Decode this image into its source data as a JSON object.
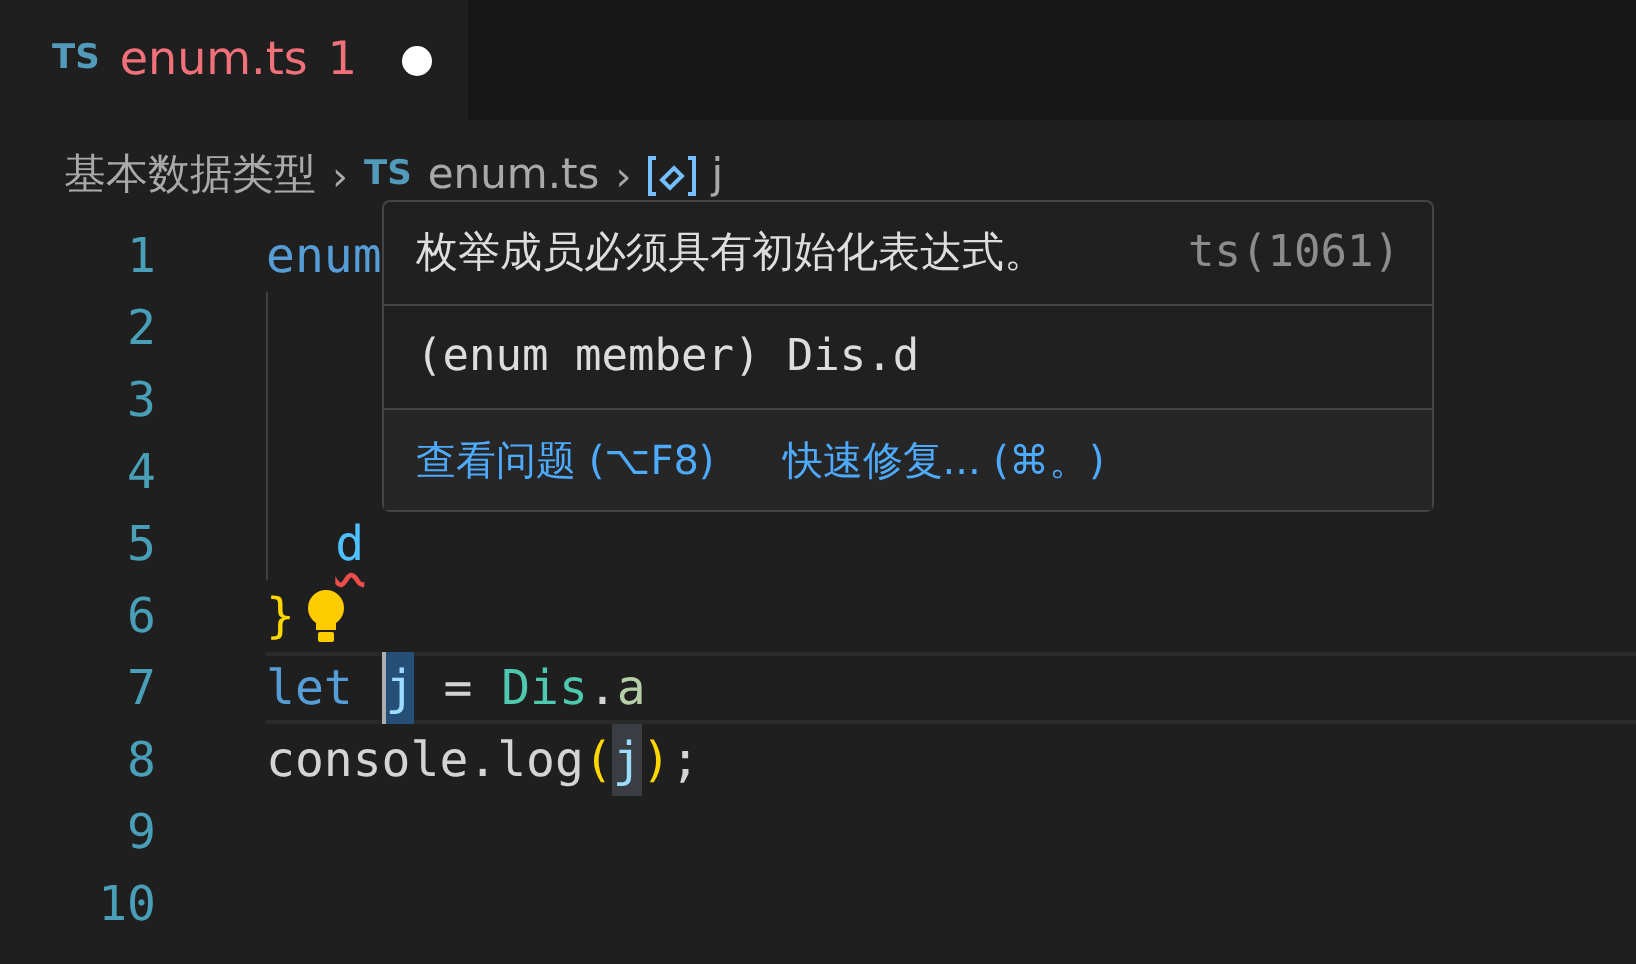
{
  "tab": {
    "icon_text": "TS",
    "name": "enum.ts",
    "problems": "1",
    "dirty": true,
    "selected": true
  },
  "breadcrumbs": [
    {
      "kind": "folder",
      "text": "基本数据类型"
    },
    {
      "kind": "file",
      "separator": "›",
      "icon_text": "TS",
      "text": "enum.ts"
    },
    {
      "kind": "symbol",
      "separator": "›",
      "text": "j"
    }
  ],
  "lines": [
    {
      "number": "1",
      "tokens": [
        {
          "kind": "keyword",
          "text": "enum"
        }
      ],
      "children": [
        {
          "number": "2"
        },
        {
          "number": "3"
        },
        {
          "number": "4"
        },
        {
          "number": "5",
          "tokens": [
            {
              "kind": "member",
              "text": "d",
              "error": true
            }
          ]
        }
      ]
    },
    {
      "number": "6",
      "lightbulb": true,
      "tokens": [
        {
          "kind": "bracket",
          "text": "}"
        }
      ]
    },
    {
      "number": "7",
      "current": true,
      "tokens": [
        {
          "kind": "keyword",
          "text": "let"
        },
        {
          "kind": "variable",
          "text": "j",
          "highlighted": true
        },
        {
          "kind": "plain",
          "text": " = "
        },
        {
          "kind": "type",
          "text": "Dis"
        },
        {
          "kind": "plain",
          "text": "."
        },
        {
          "kind": "member",
          "text": "a"
        }
      ]
    },
    {
      "number": "8",
      "tokens": [
        {
          "kind": "plain",
          "text": "console.log"
        },
        {
          "kind": "bracket",
          "text": "("
        },
        {
          "kind": "variable",
          "text": "j",
          "highlighted": true
        },
        {
          "kind": "bracket",
          "text": ")"
        },
        {
          "kind": "plain",
          "text": ";"
        }
      ]
    },
    {
      "number": "9"
    },
    {
      "number": "10"
    }
  ],
  "hover": {
    "message": "枚举成员必须具有初始化表达式。",
    "code": "ts(1061)",
    "signature": "(enum member) Dis.d",
    "actions": [
      "查看问题 (⌥F8)",
      "快速修复... (⌘。)"
    ]
  }
}
